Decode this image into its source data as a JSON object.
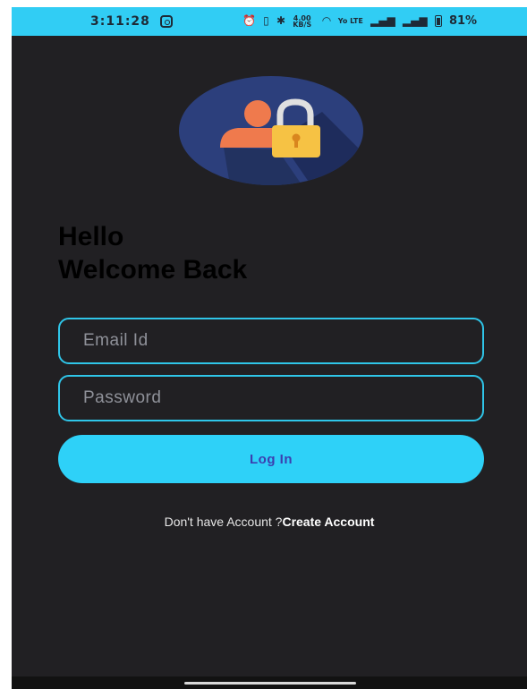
{
  "status_bar": {
    "time": "3:11:28",
    "speed_value": "4.00",
    "speed_unit": "KB/S",
    "network_label": "Yo LTE",
    "battery": "81%",
    "icons": [
      "instagram-icon",
      "alarm-icon",
      "vibrate-icon",
      "bluetooth-icon",
      "wifi-icon",
      "signal-icon",
      "battery-icon"
    ]
  },
  "login": {
    "greeting_line1": "Hello",
    "greeting_line2": "Welcome Back",
    "email_placeholder": "Email Id",
    "password_placeholder": "Password",
    "login_label": "Log In",
    "signup_prompt": "Don't have Account ?",
    "signup_link": "Create Account"
  },
  "colors": {
    "background": "#212023",
    "accent": "#2ed1f8",
    "button_text": "#3b3fb0",
    "avatar_circle": "#2c3f7c",
    "user_figure": "#ef7a4d",
    "lock_body": "#f6c244"
  }
}
